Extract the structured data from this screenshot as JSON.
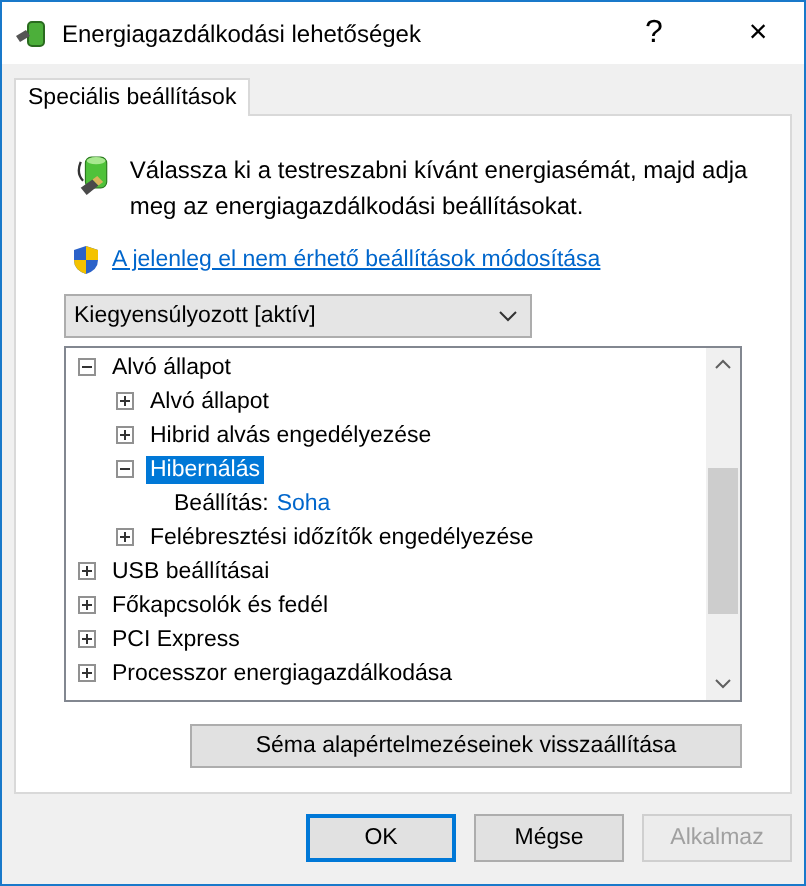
{
  "window": {
    "title": "Energiagazdálkodási lehetőségek",
    "help": "?",
    "close": "×"
  },
  "tabs": [
    {
      "label": "Speciális beállítások",
      "selected": true
    }
  ],
  "intro": "Válassza ki a testreszabni kívánt energiasémát, majd adja meg az energiagazdálkodási beállításokat.",
  "admin_link": "A jelenleg el nem érhető beállítások módosítása",
  "plan_dropdown": {
    "value": "Kiegyensúlyozott [aktív]"
  },
  "tree": [
    {
      "kind": "group",
      "label": "Alvó állapot",
      "expanded": true,
      "selected": false,
      "children": [
        {
          "kind": "group",
          "label": "Alvó állapot",
          "expanded": false,
          "selected": false
        },
        {
          "kind": "group",
          "label": "Hibrid alvás engedélyezése",
          "expanded": false,
          "selected": false
        },
        {
          "kind": "group",
          "label": "Hibernálás",
          "expanded": true,
          "selected": true,
          "children": [
            {
              "kind": "setting",
              "label": "Beállítás:",
              "value": "Soha",
              "selected": false
            }
          ]
        },
        {
          "kind": "group",
          "label": "Felébresztési időzítők engedélyezése",
          "expanded": false,
          "selected": false
        }
      ]
    },
    {
      "kind": "group",
      "label": "USB beállításai",
      "expanded": false,
      "selected": false
    },
    {
      "kind": "group",
      "label": "Főkapcsolók és fedél",
      "expanded": false,
      "selected": false
    },
    {
      "kind": "group",
      "label": "PCI Express",
      "expanded": false,
      "selected": false
    },
    {
      "kind": "group",
      "label": "Processzor energiagazdálkodása",
      "expanded": false,
      "selected": false
    }
  ],
  "restore_button": "Séma alapértelmezéseinek visszaállítása",
  "buttons": [
    {
      "label": "OK",
      "default": true,
      "disabled": false
    },
    {
      "label": "Mégse",
      "default": false,
      "disabled": false
    },
    {
      "label": "Alkalmaz",
      "default": false,
      "disabled": true
    }
  ]
}
